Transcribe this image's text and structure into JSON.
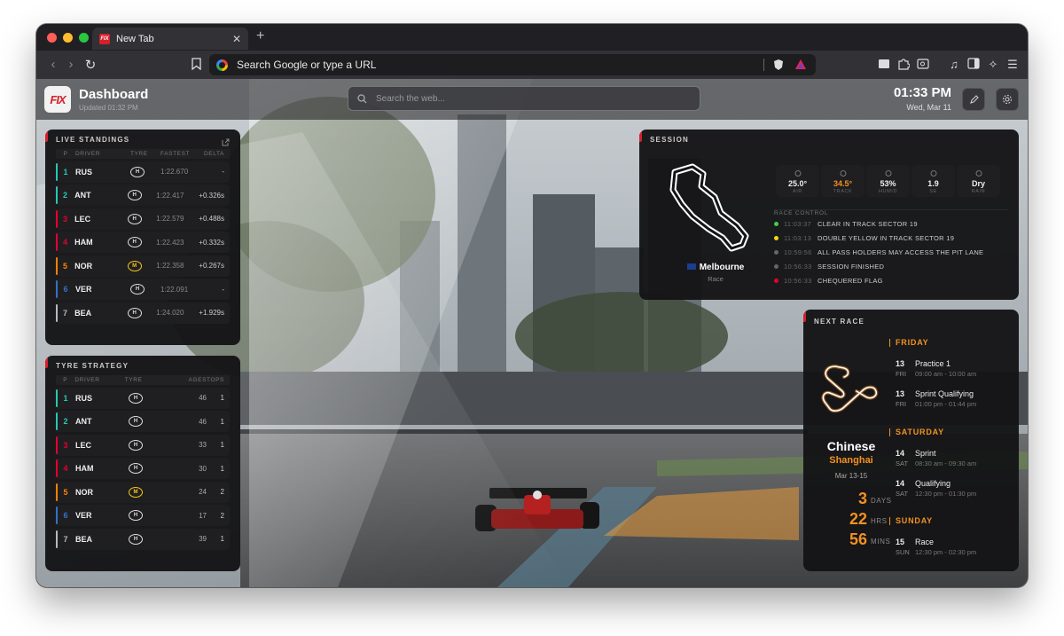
{
  "browser": {
    "tab_title": "New Tab",
    "tab_favicon": "FIX",
    "url_placeholder": "Search Google or type a URL"
  },
  "dashboard": {
    "logo": "FIX",
    "title": "Dashboard",
    "updated": "Updated 01:32 PM",
    "search_placeholder": "Search the web...",
    "time": "01:33 PM",
    "date": "Wed, Mar 11"
  },
  "standings": {
    "title": "LIVE STANDINGS",
    "headers": [
      "P",
      "DRIVER",
      "TYRE",
      "FASTEST",
      "DELTA"
    ],
    "rows": [
      {
        "pos": "1",
        "driver": "RUS",
        "tyre": "H",
        "fastest": "1:22.670",
        "delta": "-",
        "color": "#27c7b4"
      },
      {
        "pos": "2",
        "driver": "ANT",
        "tyre": "H",
        "fastest": "1:22.417",
        "delta": "+0.326s",
        "color": "#27c7b4"
      },
      {
        "pos": "3",
        "driver": "LEC",
        "tyre": "H",
        "fastest": "1:22.579",
        "delta": "+0.488s",
        "color": "#e8002d"
      },
      {
        "pos": "4",
        "driver": "HAM",
        "tyre": "H",
        "fastest": "1:22.423",
        "delta": "+0.332s",
        "color": "#e8002d"
      },
      {
        "pos": "5",
        "driver": "NOR",
        "tyre": "M",
        "fastest": "1:22.358",
        "delta": "+0.267s",
        "color": "#ff8000"
      },
      {
        "pos": "6",
        "driver": "VER",
        "tyre": "H",
        "fastest": "1:22.091",
        "delta": "-",
        "color": "#3671c6"
      },
      {
        "pos": "7",
        "driver": "BEA",
        "tyre": "H",
        "fastest": "1:24.020",
        "delta": "+1.929s",
        "color": "#b6babd"
      }
    ]
  },
  "strategy": {
    "title": "TYRE STRATEGY",
    "headers": [
      "P",
      "DRIVER",
      "TYRE",
      "AGE",
      "STOPS"
    ],
    "rows": [
      {
        "pos": "1",
        "driver": "RUS",
        "tyre": "H",
        "age": "46",
        "stops": "1",
        "color": "#27c7b4"
      },
      {
        "pos": "2",
        "driver": "ANT",
        "tyre": "H",
        "age": "46",
        "stops": "1",
        "color": "#27c7b4"
      },
      {
        "pos": "3",
        "driver": "LEC",
        "tyre": "H",
        "age": "33",
        "stops": "1",
        "color": "#e8002d"
      },
      {
        "pos": "4",
        "driver": "HAM",
        "tyre": "H",
        "age": "30",
        "stops": "1",
        "color": "#e8002d"
      },
      {
        "pos": "5",
        "driver": "NOR",
        "tyre": "M",
        "age": "24",
        "stops": "2",
        "color": "#ff8000"
      },
      {
        "pos": "6",
        "driver": "VER",
        "tyre": "H",
        "age": "17",
        "stops": "2",
        "color": "#3671c6"
      },
      {
        "pos": "7",
        "driver": "BEA",
        "tyre": "H",
        "age": "39",
        "stops": "1",
        "color": "#b6babd"
      }
    ]
  },
  "session": {
    "title": "SESSION",
    "circuit": "Melbourne",
    "session_type": "Race",
    "weather": [
      {
        "value": "25.0°",
        "label": "AIR",
        "icon": "thermometer-icon",
        "accent": false
      },
      {
        "value": "34.5°",
        "label": "TRACK",
        "icon": "thermometer-icon",
        "accent": true
      },
      {
        "value": "53%",
        "label": "HUMID",
        "icon": "droplet-icon",
        "accent": false
      },
      {
        "value": "1.9",
        "label": "SE",
        "icon": "wind-flag-icon",
        "accent": false
      },
      {
        "value": "Dry",
        "label": "RAIN",
        "icon": "cloud-icon",
        "accent": false
      }
    ],
    "race_control_title": "RACE CONTROL",
    "race_control": [
      {
        "time": "11:03:37",
        "msg": "CLEAR IN TRACK SECTOR 19",
        "color": "#3ecf4a"
      },
      {
        "time": "11:03:13",
        "msg": "DOUBLE YELLOW IN TRACK SECTOR 19",
        "color": "#f5d90a"
      },
      {
        "time": "10:59:56",
        "msg": "ALL PASS HOLDERS MAY ACCESS THE PIT LANE",
        "color": "#666666"
      },
      {
        "time": "10:56:33",
        "msg": "SESSION FINISHED",
        "color": "#666666"
      },
      {
        "time": "10:56:33",
        "msg": "CHEQUERED FLAG",
        "color": "#e8002d"
      }
    ]
  },
  "next_race": {
    "title": "NEXT RACE",
    "name": "Chinese",
    "city": "Shanghai",
    "dates": "Mar 13-15",
    "countdown": [
      {
        "value": "3",
        "unit": "DAYS"
      },
      {
        "value": "22",
        "unit": "HRS"
      },
      {
        "value": "56",
        "unit": "MINS"
      }
    ],
    "schedule": [
      {
        "day": "FRIDAY",
        "events": [
          {
            "date": "13",
            "dow": "FRI",
            "name": "Practice 1",
            "time": "09:00 am - 10:00 am"
          },
          {
            "date": "13",
            "dow": "FRI",
            "name": "Sprint Qualifying",
            "time": "01:00 pm - 01:44 pm"
          }
        ]
      },
      {
        "day": "SATURDAY",
        "events": [
          {
            "date": "14",
            "dow": "SAT",
            "name": "Sprint",
            "time": "08:30 am - 09:30 am"
          },
          {
            "date": "14",
            "dow": "SAT",
            "name": "Qualifying",
            "time": "12:30 pm - 01:30 pm"
          }
        ]
      },
      {
        "day": "SUNDAY",
        "events": [
          {
            "date": "15",
            "dow": "SUN",
            "name": "Race",
            "time": "12:30 pm - 02:30 pm"
          }
        ]
      }
    ]
  },
  "colors": {
    "accent": "#f29120",
    "brand": "#d6202c"
  }
}
